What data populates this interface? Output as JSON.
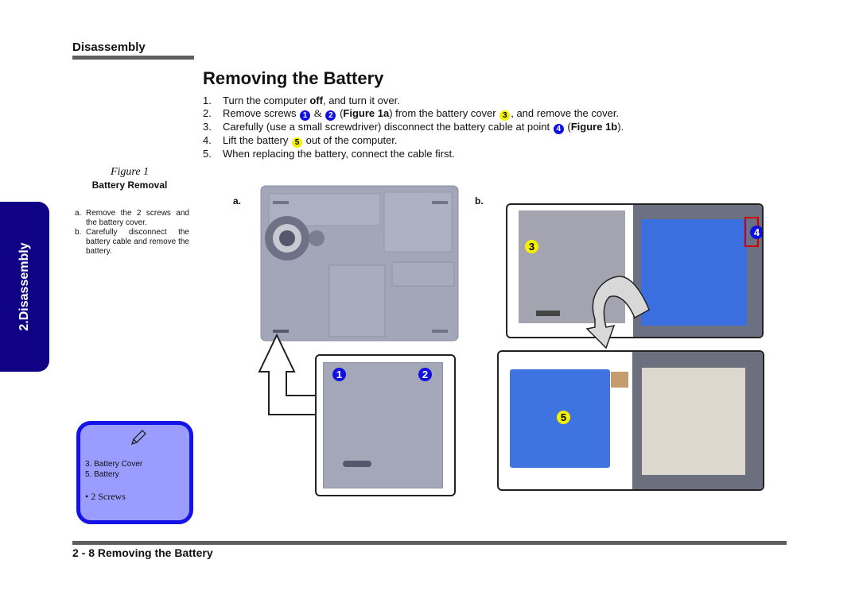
{
  "header": {
    "section": "Disassembly",
    "title": "Removing the Battery"
  },
  "steps": [
    {
      "num": "1.",
      "parts": [
        "Turn the computer ",
        "off",
        ", and turn it over."
      ]
    },
    {
      "num": "2.",
      "parts": [
        "Remove screws ",
        "1",
        "&",
        "2",
        "(",
        "Figure 1a",
        ") from the battery cover ",
        "3",
        ", and remove the cover."
      ]
    },
    {
      "num": "3.",
      "parts": [
        "Carefully (use a small screwdriver) disconnect the battery cable at point ",
        "4",
        "(",
        "Figure 1b",
        ")."
      ]
    },
    {
      "num": "4.",
      "parts": [
        "Lift the battery ",
        "5",
        " out of the computer."
      ]
    },
    {
      "num": "5.",
      "parts": [
        "When replacing the battery, connect the cable first."
      ]
    }
  ],
  "figure": {
    "caption": "Figure 1",
    "title": "Battery Removal",
    "notes": [
      {
        "letter": "a.",
        "text": "Remove the 2 screws and the battery cover."
      },
      {
        "letter": "b.",
        "text": "Carefully disconnect the battery cable and remove the battery."
      }
    ],
    "panel_a_label": "a.",
    "panel_b_label": "b.",
    "callouts": {
      "c1": "1",
      "c2": "2",
      "c3": "3",
      "c4": "4",
      "c5": "5"
    }
  },
  "side_tab": {
    "label": "2.Disassembly"
  },
  "note_box": {
    "icon": "pen-icon",
    "lines": [
      "3.  Battery Cover",
      "5.  Battery"
    ],
    "bullet": "•   2 Screws"
  },
  "footer": {
    "text": "2 - 8  Removing the Battery"
  },
  "colors": {
    "tab": "#0f0285",
    "callout_blue": "#1010e0",
    "callout_yellow": "#f4f000",
    "note_fill": "#9a9cff",
    "note_border": "#1414e6"
  }
}
